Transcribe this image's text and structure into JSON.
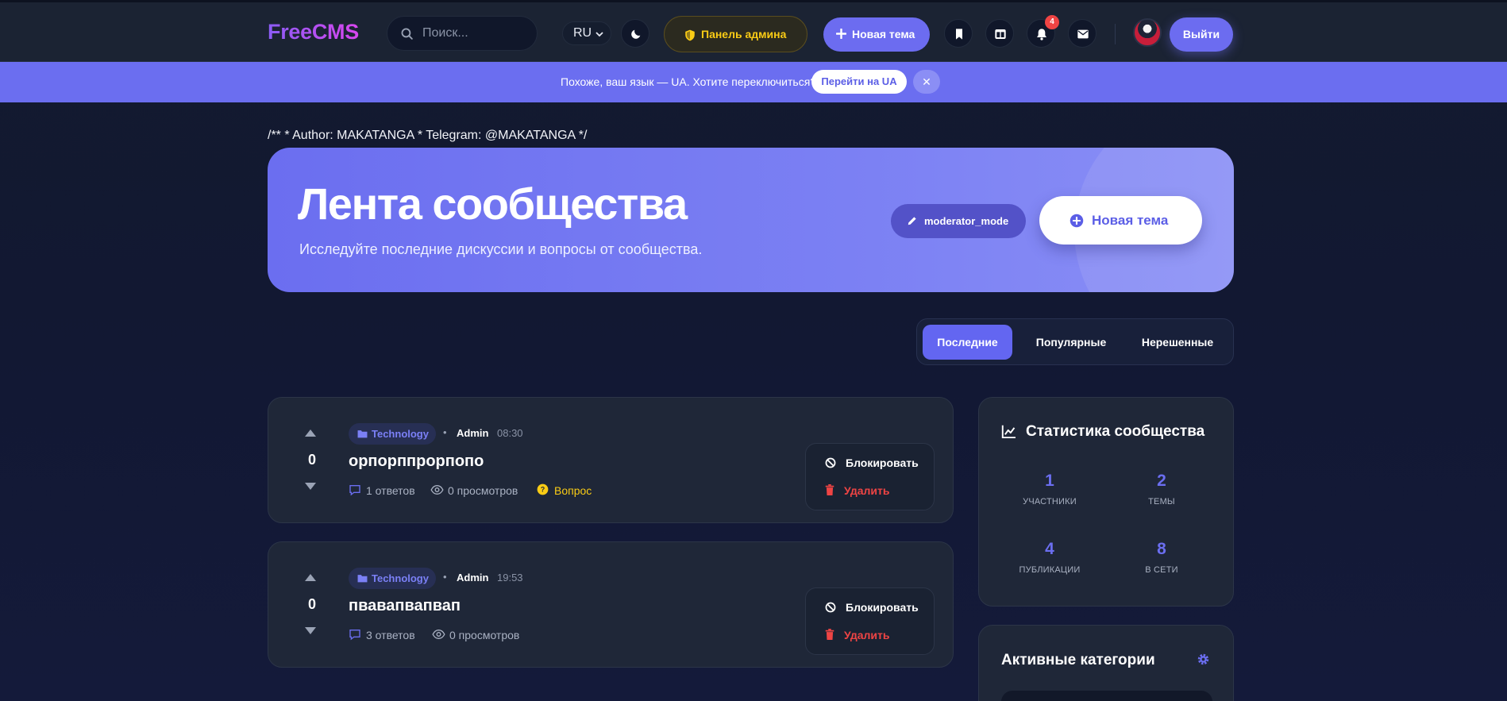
{
  "header": {
    "logo": "FreeCMS",
    "search_placeholder": "Поиск...",
    "language": "RU",
    "admin_panel_label": "Панель админа",
    "new_topic_label": "Новая тема",
    "notifications_count": "4",
    "logout_label": "Выйти",
    "icons": [
      "search-icon",
      "moon-icon",
      "shield-icon",
      "plus-icon",
      "bookmark-icon",
      "columns-icon",
      "bell-icon",
      "mail-icon"
    ]
  },
  "language_bar": {
    "message": "Похоже, ваш язык — UA. Хотите переключиться?",
    "switch_label": "Перейти на UA",
    "close_label": "✕"
  },
  "author_line": "/** * Author: MAKATANGA * Telegram: @MAKATANGA */",
  "hero": {
    "title": "Лента сообщества",
    "subtitle": "Исследуйте последние дискуссии и вопросы от сообщества.",
    "moderator_mode_label": "moderator_mode",
    "new_topic_label": "Новая тема"
  },
  "tabs": [
    {
      "label": "Последние",
      "active": true
    },
    {
      "label": "Популярные",
      "active": false
    },
    {
      "label": "Нерешенные",
      "active": false
    }
  ],
  "posts": [
    {
      "votes": "0",
      "category": "Technology",
      "author": "Admin",
      "time": "08:30",
      "title": "орпорппрорпопо",
      "answers": "1 ответов",
      "views": "0 просмотров",
      "tag": "Вопрос",
      "block_label": "Блокировать",
      "delete_label": "Удалить"
    },
    {
      "votes": "0",
      "category": "Technology",
      "author": "Admin",
      "time": "19:53",
      "title": "пвавапвапвап",
      "answers": "3 ответов",
      "views": "0 просмотров",
      "block_label": "Блокировать",
      "delete_label": "Удалить"
    }
  ],
  "community_stats": {
    "title": "Статистика сообщества",
    "items": [
      {
        "value": "1",
        "label": "УЧАСТНИКИ"
      },
      {
        "value": "2",
        "label": "ТЕМЫ"
      },
      {
        "value": "4",
        "label": "ПУБЛИКАЦИИ"
      },
      {
        "value": "8",
        "label": "В СЕТИ"
      }
    ]
  },
  "active_categories": {
    "title": "Активные категории"
  },
  "colors": {
    "accent": "#6b6ef0",
    "admin_yellow": "#facc15",
    "danger": "#ef4444",
    "background": "#131a2e",
    "card": "#1f2738"
  }
}
